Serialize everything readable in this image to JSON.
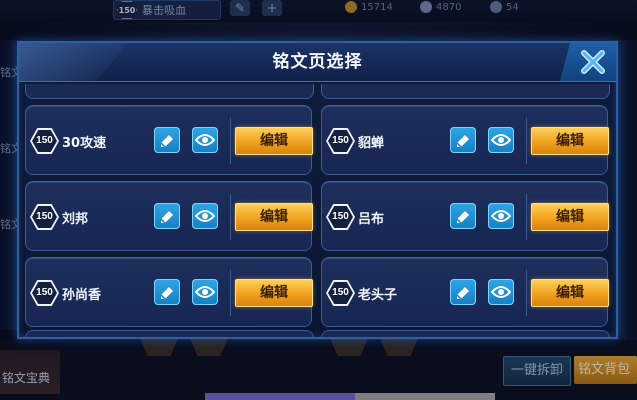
{
  "background": {
    "top_badge_level": "150",
    "top_badge_text": "暴击吸血",
    "top_stat_1": "15714",
    "top_stat_2": "4870",
    "top_stat_3": "54",
    "left_label_1": "铭文",
    "left_label_2": "铭文",
    "left_label_3": "铭文",
    "bottom_left_label": "铭文宝典",
    "bottom_btn_blue": "一键拆卸",
    "bottom_btn_gold": "铭文背包"
  },
  "modal": {
    "title": "铭文页选择",
    "close_icon": "close-x-icon"
  },
  "pages": [
    {
      "level": "150",
      "name": "30攻速",
      "edit_label": "编辑"
    },
    {
      "level": "150",
      "name": "貂蝉",
      "edit_label": "编辑"
    },
    {
      "level": "150",
      "name": "刘邦",
      "edit_label": "编辑"
    },
    {
      "level": "150",
      "name": "吕布",
      "edit_label": "编辑"
    },
    {
      "level": "150",
      "name": "孙尚香",
      "edit_label": "编辑"
    },
    {
      "level": "150",
      "name": "老头子",
      "edit_label": "编辑"
    }
  ],
  "icons": {
    "rename": "pencil-eraser-icon",
    "preview": "eye-icon"
  },
  "colors": {
    "accent_blue": "#2fa6e6",
    "edit_gold": "#f1a11e",
    "frame_blue": "#2e5fa2"
  }
}
